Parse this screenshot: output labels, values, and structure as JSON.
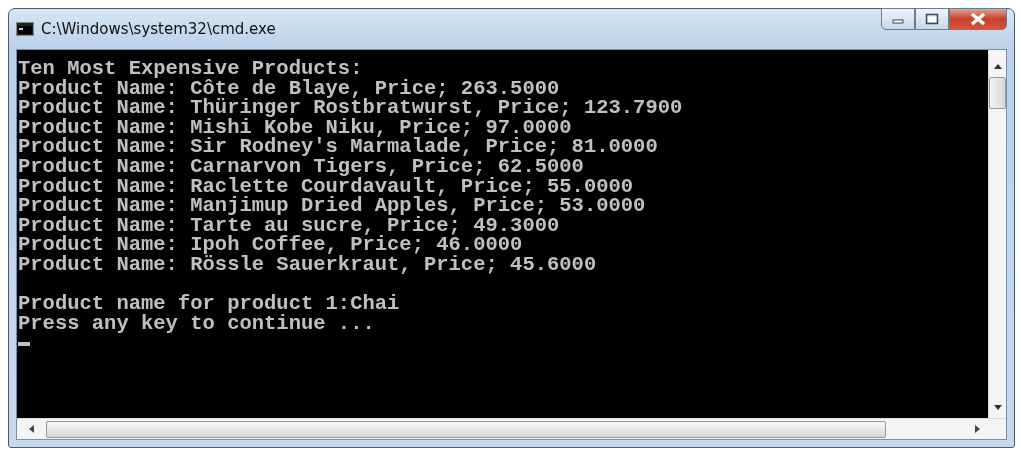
{
  "window": {
    "title": "C:\\Windows\\system32\\cmd.exe"
  },
  "console": {
    "heading": "Ten Most Expensive Products:",
    "product_lines": [
      "Product Name: Côte de Blaye, Price; 263.5000",
      "Product Name: Thüringer Rostbratwurst, Price; 123.7900",
      "Product Name: Mishi Kobe Niku, Price; 97.0000",
      "Product Name: Sir Rodney's Marmalade, Price; 81.0000",
      "Product Name: Carnarvon Tigers, Price; 62.5000",
      "Product Name: Raclette Courdavault, Price; 55.0000",
      "Product Name: Manjimup Dried Apples, Price; 53.0000",
      "Product Name: Tarte au sucre, Price; 49.3000",
      "Product Name: Ipoh Coffee, Price; 46.0000",
      "Product Name: Rössle Sauerkraut, Price; 45.6000"
    ],
    "result_lines": [
      "Product name for product 1:Chai",
      "Press any key to continue ..."
    ]
  }
}
